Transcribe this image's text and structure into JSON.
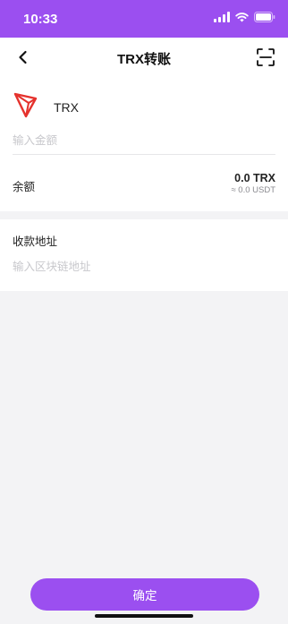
{
  "status_bar": {
    "time": "10:33"
  },
  "navbar": {
    "title": "TRX转账",
    "icons": {
      "back": "chevron-left-icon",
      "scan": "scan-icon"
    }
  },
  "coin": {
    "name": "TRX",
    "logo": "tron-logo"
  },
  "amount": {
    "placeholder": "输入金额",
    "value": ""
  },
  "balance": {
    "label": "余额",
    "amount": "0.0 TRX",
    "usdt": "≈ 0.0 USDT"
  },
  "address": {
    "label": "收款地址",
    "placeholder": "输入区块链地址",
    "value": ""
  },
  "confirm_label": "确定",
  "colors": {
    "accent": "#9b4ff0",
    "tron_red": "#e5322d",
    "background": "#f3f3f5"
  }
}
